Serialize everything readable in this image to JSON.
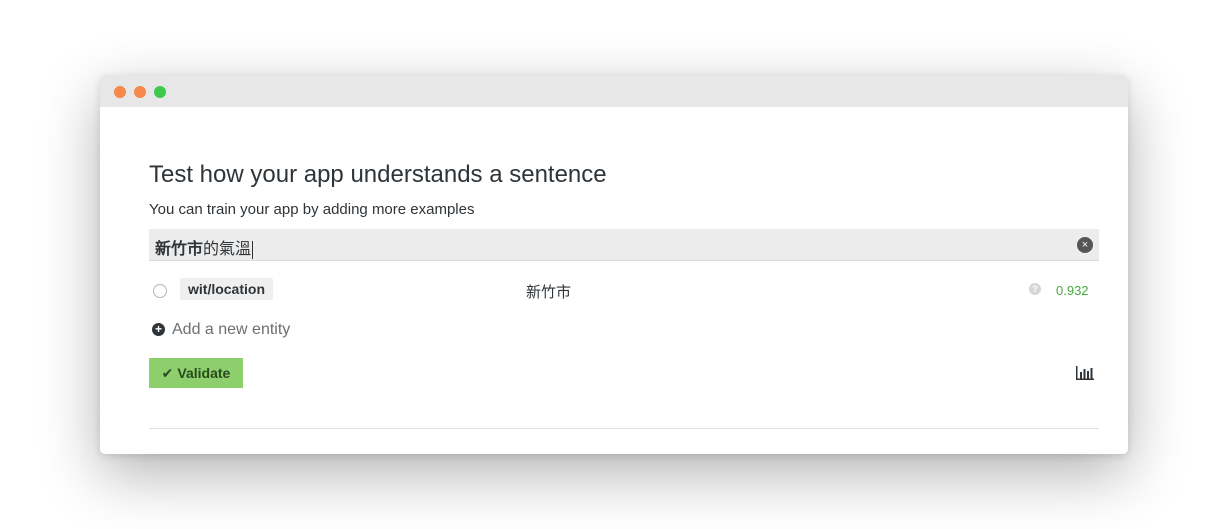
{
  "window": {
    "controls": {
      "close_color": "#f5884a",
      "minimize_color": "#f5884a",
      "maximize_color": "#3cc94c"
    }
  },
  "header": {
    "title": "Test how your app understands a sentence",
    "subtitle": "You can train your app by adding more examples"
  },
  "sentence_input": {
    "value_highlighted": "新竹市",
    "value_rest": "的氣溫",
    "clear_icon": "close-circle-icon"
  },
  "entities": [
    {
      "name": "wit/location",
      "value": "新竹市",
      "confidence": "0.932",
      "confidence_color": "#46a83a"
    }
  ],
  "actions": {
    "add_entity_label": "Add a new entity",
    "validate_label": "Validate",
    "validate_color": "#8ccf6c"
  }
}
